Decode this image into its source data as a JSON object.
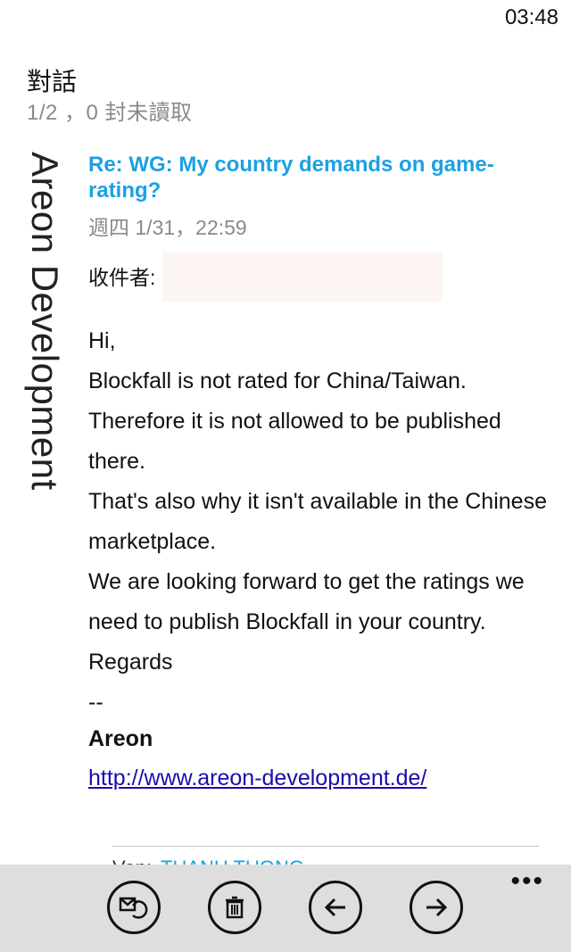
{
  "status_bar": {
    "time": "03:48"
  },
  "header": {
    "title": "對話",
    "subtitle": "1/2 ，0 封未讀取"
  },
  "sender": {
    "name": "Areon Development"
  },
  "message": {
    "subject": "Re: WG: My country demands on game-rating?",
    "date": "週四 1/31，22:59",
    "to_label": "收件者:",
    "body_lines": [
      "Hi,",
      "Blockfall is not rated for China/Taiwan.",
      "Therefore it is not allowed to be published there.",
      "That's also why it isn't available in the Chinese marketplace.",
      "We are looking forward to get the ratings we need to publish Blockfall in your country.",
      "Regards",
      "--"
    ],
    "signature": "Areon",
    "link": "http://www.areon-development.de/"
  },
  "next_message_peek": {
    "prefix": "Von:",
    "name": "THANH TUONG"
  },
  "app_bar": {
    "buttons": [
      {
        "icon": "reply-icon"
      },
      {
        "icon": "delete-icon"
      },
      {
        "icon": "back-arrow-icon"
      },
      {
        "icon": "forward-arrow-icon"
      }
    ],
    "more_label": "•••"
  }
}
